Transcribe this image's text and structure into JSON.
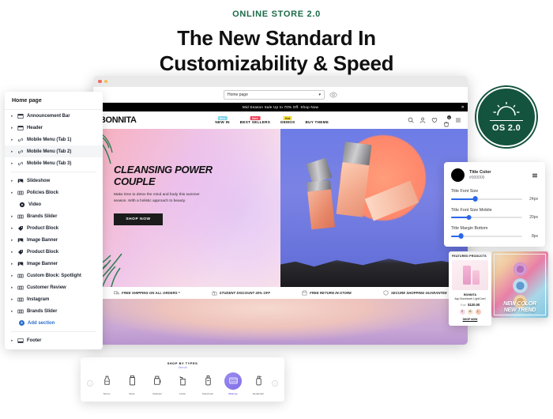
{
  "headline": {
    "eyebrow": "ONLINE STORE 2.0",
    "line1": "The New Standard In",
    "line2": "Customizability & Speed"
  },
  "badge": {
    "label": "OS 2.0",
    "icon": "sunrise-icon",
    "color": "#14543f"
  },
  "browser": {
    "page_selector": {
      "value": "Home page",
      "caret": "▾"
    },
    "preview_icon": "preview-eye-icon"
  },
  "storefront": {
    "announcement": {
      "text": "Mid Season Sale Up to 70% Off. Shop Now",
      "close": "✕"
    },
    "logo": "BONNITA",
    "nav": [
      {
        "label": "NEW IN",
        "badge": "New",
        "badge_color": "#7fd4ea"
      },
      {
        "label": "BEST SELLERS",
        "badge": "Sale",
        "badge_color": "#f0445a"
      },
      {
        "label": "DEMOS",
        "badge": "Hot",
        "badge_color": "#f5dd3f"
      },
      {
        "label": "BUY THEME",
        "badge": "",
        "badge_color": ""
      }
    ],
    "icons": [
      "search-icon",
      "account-icon",
      "wishlist-icon",
      "cart-icon",
      "menu-icon"
    ],
    "cart_count": "0",
    "hero": {
      "title": "CLEANSING POWER COUPLE",
      "subtitle": "Make time to detox the mind and body this summer season. With a holistic approach to beauty.",
      "cta": "SHOP NOW"
    },
    "trust": [
      {
        "label": "FREE SHIPPING ON ALL ORDERS *",
        "icon": "truck-icon"
      },
      {
        "label": "STUDENT DISCOUNT 40% OFF",
        "icon": "gift-icon"
      },
      {
        "label": "FREE RETURN IN-STORE",
        "icon": "store-icon"
      },
      {
        "label": "SECURE SHOPPING GUARANTEE",
        "icon": "shield-icon"
      }
    ]
  },
  "sections_panel": {
    "title": "Home page",
    "add_label": "Add section",
    "items": [
      {
        "label": "Announcement Bar",
        "icon": "layout-bar-icon",
        "expandable": true
      },
      {
        "label": "Header",
        "icon": "layout-bar-icon",
        "expandable": true
      },
      {
        "label": "Mobile Menu (Tab 1)",
        "icon": "link-icon",
        "expandable": true
      },
      {
        "label": "Mobile Menu (Tab 2)",
        "icon": "link-icon",
        "expandable": true,
        "active": true
      },
      {
        "label": "Mobile Menu (Tab 3)",
        "icon": "link-icon",
        "expandable": true
      },
      {
        "label": "Slideshow",
        "icon": "image-icon",
        "expandable": true
      },
      {
        "label": "Policies Block",
        "icon": "grid-icon",
        "expandable": true
      },
      {
        "label": "Video",
        "icon": "video-icon",
        "expandable": false
      },
      {
        "label": "Brands Slider",
        "icon": "grid-icon",
        "expandable": true
      },
      {
        "label": "Product Block",
        "icon": "tag-icon",
        "expandable": true
      },
      {
        "label": "Image Banner",
        "icon": "image-icon",
        "expandable": true
      },
      {
        "label": "Product Block",
        "icon": "tag-icon",
        "expandable": true
      },
      {
        "label": "Image Banner",
        "icon": "image-icon",
        "expandable": true
      },
      {
        "label": "Custom Block: Spotlight",
        "icon": "grid-icon",
        "expandable": true
      },
      {
        "label": "Customer Review",
        "icon": "grid-icon",
        "expandable": true
      },
      {
        "label": "Instagram",
        "icon": "grid-icon",
        "expandable": true
      },
      {
        "label": "Brands Slider",
        "icon": "grid-icon",
        "expandable": true
      }
    ],
    "footer_item": {
      "label": "Footer",
      "icon": "footer-icon",
      "expandable": true
    }
  },
  "settings_panel": {
    "color_title": "Title Color",
    "color_hex": "#000000",
    "menu_icon": "list-menu-icon",
    "sliders": [
      {
        "label": "Title Font Size",
        "value": "24px",
        "pct": 34
      },
      {
        "label": "Title Font Size Mobile",
        "value": "20px",
        "pct": 25
      },
      {
        "label": "Title Margin Bottom",
        "value": "8px",
        "pct": 14
      }
    ],
    "accent": "#2a67e8"
  },
  "featured_card": {
    "heading": "FEATURED PRODUCTS",
    "brand": "BONNITA",
    "name": "App Bonnitavel LightCarel",
    "from_label": "From",
    "price": "$120.00",
    "swatches": [
      "S",
      "M",
      "L"
    ],
    "cta": "SHOP NOW"
  },
  "promo_card": {
    "line1": "NEW COLOR",
    "line2": "NEW TREND"
  },
  "types_bar": {
    "title": "SHOP BY TYPES",
    "subtitle": "View all",
    "prev": "‹",
    "next": "›",
    "items": [
      {
        "label": "Serum",
        "icon": "serum-icon",
        "selected": false
      },
      {
        "label": "Rose",
        "icon": "bottle-icon",
        "selected": false
      },
      {
        "label": "Cleanser",
        "icon": "jar-icon",
        "selected": false
      },
      {
        "label": "Lotion",
        "icon": "pump-icon",
        "selected": false
      },
      {
        "label": "Sunscreen",
        "icon": "tube-icon",
        "selected": false
      },
      {
        "label": "Makeup",
        "icon": "palette-icon",
        "selected": true
      },
      {
        "label": "Deodorant",
        "icon": "spray-icon",
        "selected": false
      }
    ]
  }
}
